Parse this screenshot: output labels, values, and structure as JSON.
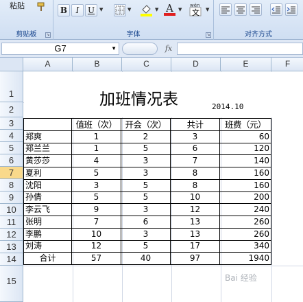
{
  "ribbon": {
    "clipboard": {
      "paste_label": "粘贴",
      "group_label": "剪贴板"
    },
    "font": {
      "bold": "B",
      "italic": "I",
      "underline": "U",
      "wen": "文",
      "group_label": "字体"
    },
    "alignment": {
      "group_label": "对齐方式"
    }
  },
  "formula_bar": {
    "name_box": "G7",
    "fx_label": "fx",
    "formula": ""
  },
  "sheet": {
    "columns": [
      "A",
      "B",
      "C",
      "D",
      "E",
      "F"
    ],
    "rows": [
      "1",
      "2",
      "3",
      "4",
      "5",
      "6",
      "7",
      "8",
      "9",
      "10",
      "11",
      "12",
      "13",
      "14",
      "15"
    ],
    "selected_row": "7",
    "title": "加班情况表",
    "date": "2014.10",
    "table": {
      "headers": [
        "",
        "值班（次）",
        "开会（次）",
        "共计",
        "班费（元）"
      ],
      "rows": [
        [
          "郑爽",
          "1",
          "2",
          "3",
          "60"
        ],
        [
          "郑兰兰",
          "1",
          "5",
          "6",
          "120"
        ],
        [
          "黄莎莎",
          "4",
          "3",
          "7",
          "140"
        ],
        [
          "夏利",
          "5",
          "3",
          "8",
          "160"
        ],
        [
          "沈阳",
          "3",
          "5",
          "8",
          "160"
        ],
        [
          "孙倩",
          "5",
          "5",
          "10",
          "200"
        ],
        [
          "李云飞",
          "9",
          "3",
          "12",
          "240"
        ],
        [
          "张明",
          "7",
          "6",
          "13",
          "260"
        ],
        [
          "李鹏",
          "10",
          "3",
          "13",
          "260"
        ],
        [
          "刘涛",
          "12",
          "5",
          "17",
          "340"
        ],
        [
          "合计",
          "57",
          "40",
          "97",
          "1940"
        ]
      ]
    }
  },
  "watermark": "Bai 经验"
}
